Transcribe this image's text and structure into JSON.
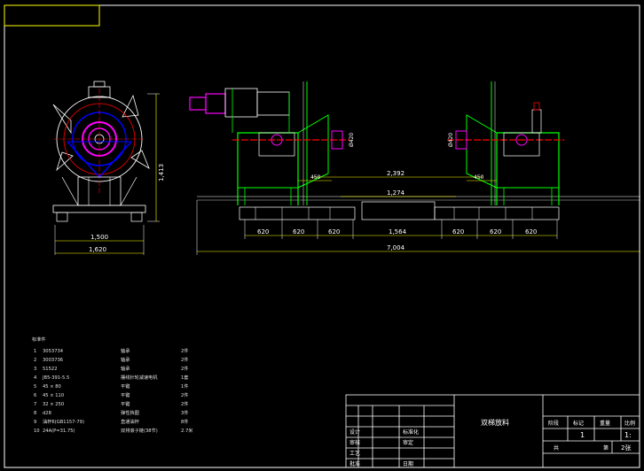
{
  "dimensions": {
    "side_height": "1,413",
    "side_inner_width": "1,500",
    "side_outer_width": "1,620",
    "front_top": "2,392",
    "front_mid": "1,274",
    "front_center": "1,564",
    "front_total": "7,004",
    "seg_1": "620",
    "seg_2": "620",
    "seg_3": "620",
    "seg_4": "620",
    "seg_5": "620",
    "seg_6": "620",
    "offset_left": "450",
    "offset_right": "450",
    "dia_left": "Ø420",
    "dia_right": "Ø420"
  },
  "bom": {
    "title": "标准件",
    "items": [
      {
        "no": "1",
        "code": "3053734",
        "name": "轴承",
        "qty": "2件"
      },
      {
        "no": "2",
        "code": "3003736",
        "name": "轴承",
        "qty": "2件"
      },
      {
        "no": "3",
        "code": "51522",
        "name": "轴承",
        "qty": "2件"
      },
      {
        "no": "4",
        "code": "JB5-391-5.5",
        "name": "摆线针轮减速电机",
        "qty": "1套"
      },
      {
        "no": "5",
        "code": "45 × 80",
        "name": "平键",
        "qty": "1件"
      },
      {
        "no": "6",
        "code": "45 × 110",
        "name": "平键",
        "qty": "2件"
      },
      {
        "no": "7",
        "code": "32 × 250",
        "name": "平键",
        "qty": "2件"
      },
      {
        "no": "8",
        "code": "d28",
        "name": "弹性挡圈",
        "qty": "3件"
      },
      {
        "no": "9",
        "code": "油杯6(GB1157-79)",
        "name": "直通油杯",
        "qty": "8件"
      },
      {
        "no": "10",
        "code": "24A(P=31.75)",
        "name": "双排滚子链(38节)",
        "qty": "2.7米"
      }
    ]
  },
  "title_block": {
    "drawing_title": "双梯放料",
    "row_labels": [
      "设计",
      "审核",
      "工艺",
      "批准"
    ],
    "right_labels": [
      "标准化",
      "审定",
      "日期"
    ],
    "header_cells": [
      "阶段",
      "标记",
      "重量",
      "比例"
    ],
    "weight_value": "1",
    "scale_value": "1:",
    "sheet_label_left": "共",
    "sheet_label_right": "第",
    "sheet_value": "2张"
  },
  "colors": {
    "background": "#000000",
    "frame": "#ffffff",
    "structure": "#00ff00",
    "drive": "#ff00ff",
    "shaft": "#ff0000",
    "dimension": "#ffff00",
    "axle": "#0000ff",
    "outline": "#ffffff"
  }
}
